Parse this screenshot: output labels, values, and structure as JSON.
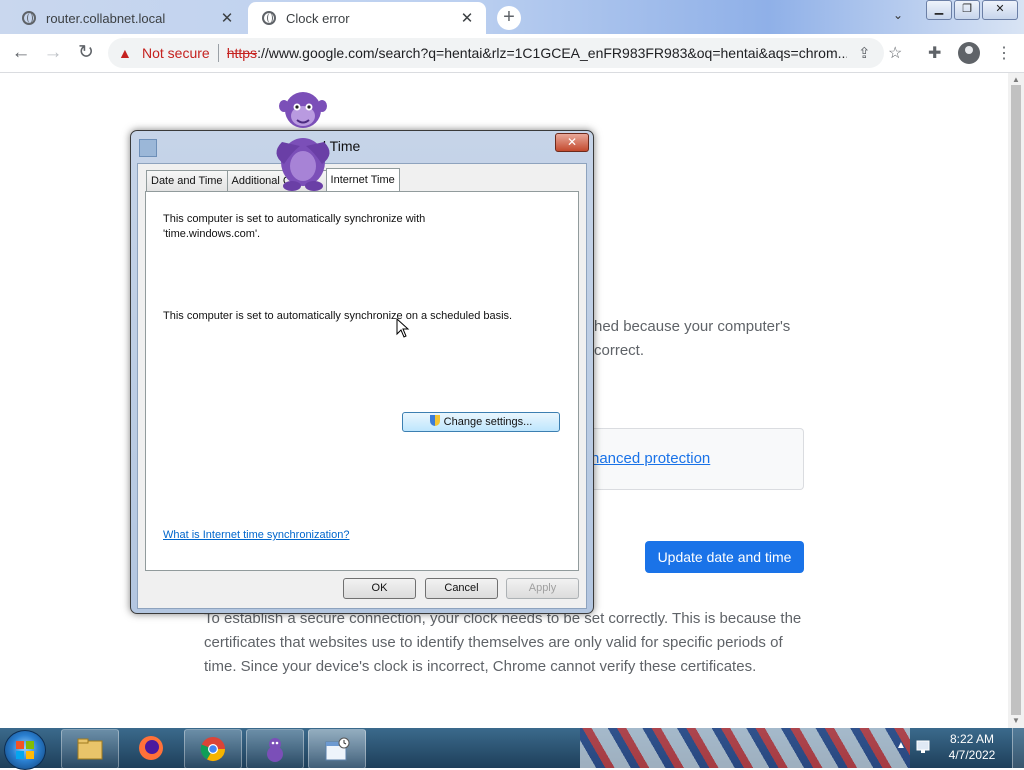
{
  "browser": {
    "tabs": [
      {
        "title": "router.collabnet.local",
        "close": "✕"
      },
      {
        "title": "Clock error",
        "close": "✕"
      }
    ],
    "new_tab": "+",
    "address": {
      "security_label": "Not secure",
      "url_scheme": "https",
      "url_rest": "://www.google.com/search?q=hentai&rlz=1C1GCEA_enFR983FR983&oq=hentai&aqs=chrom..."
    }
  },
  "page": {
    "text_partial_1": "hed because your computer's",
    "text_partial_2": "correct.",
    "enhanced_link": "hanced protection",
    "update_button": "Update date and time",
    "explanation": "To establish a secure connection, your clock needs to be set correctly. This is because the certificates that websites use to identify themselves are only valid for specific periods of time. Since your device's clock is incorrect, Chrome cannot verify these certificates."
  },
  "dialog": {
    "title": "e and Time",
    "close": "✕",
    "tabs": [
      "Date and Time",
      "Additional Clocks",
      "Internet Time"
    ],
    "sync_server_text": "This computer is set to automatically synchronize with 'time.windows.com'.",
    "schedule_text": "This computer is set to automatically synchronize on a scheduled basis.",
    "change_button": "Change settings...",
    "help_link": "What is Internet time synchronization?",
    "ok": "OK",
    "cancel": "Cancel",
    "apply": "Apply"
  },
  "taskbar": {
    "items": [
      "windows-explorer",
      "firefox",
      "chrome",
      "bonzibuddy",
      "date-time-control-panel"
    ],
    "time": "8:22 AM",
    "date": "4/7/2022"
  },
  "colors": {
    "chrome_accent": "#1a73e8",
    "not_secure": "#c5221f",
    "bonzi_purple": "#7b4fb8"
  }
}
